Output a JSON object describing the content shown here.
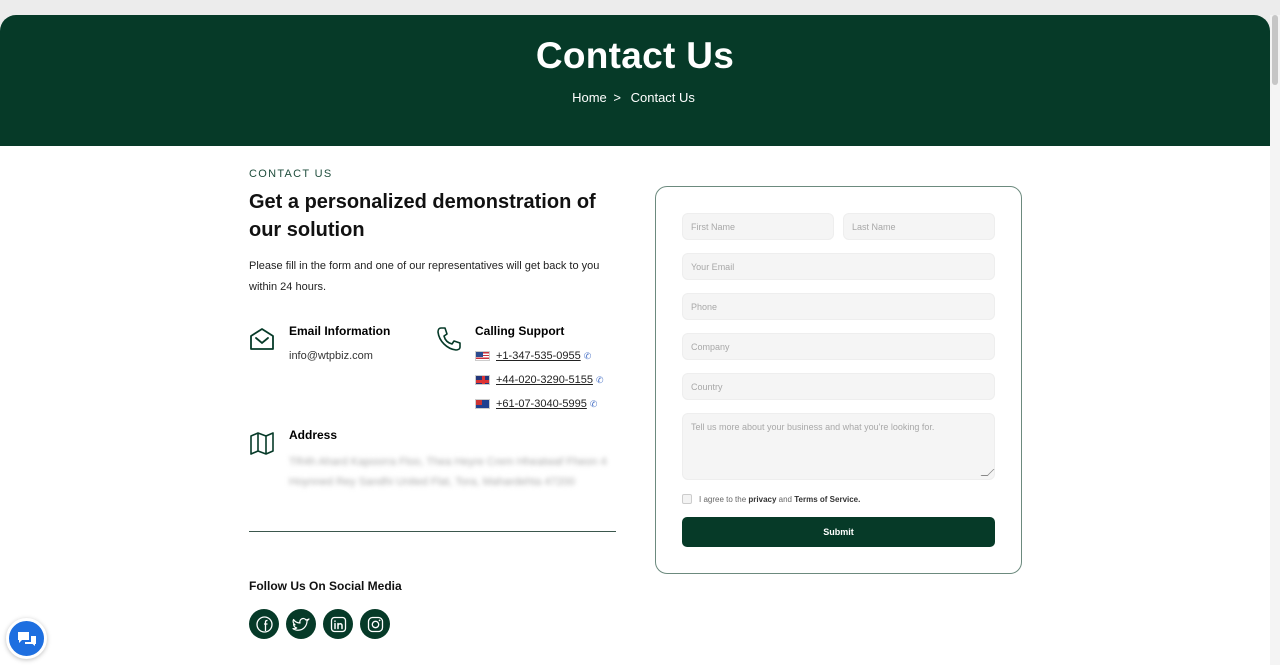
{
  "hero": {
    "title": "Contact Us",
    "breadcrumb_home": "Home",
    "breadcrumb_sep": ">",
    "breadcrumb_current": "Contact Us"
  },
  "intro": {
    "eyebrow": "CONTACT US",
    "headline": "Get a personalized demonstration of our solution",
    "description": "Please fill in the form and one of our representatives will get back to you within 24 hours."
  },
  "email": {
    "title": "Email Information",
    "value": "info@wtpbiz.com",
    "icon": "envelope-open-icon"
  },
  "calling": {
    "title": "Calling Support",
    "icon": "phone-icon",
    "phones": [
      {
        "flag": "us-flag-icon",
        "number": "+1-347-535-0955"
      },
      {
        "flag": "uk-flag-icon",
        "number": "+44-020-3290-5155"
      },
      {
        "flag": "au-flag-icon",
        "number": "+61-07-3040-5995"
      }
    ]
  },
  "address": {
    "title": "Address",
    "icon": "map-icon",
    "line1": "TR4h Ahard Kapoorra Floo, Thea Heyre Crem Hheatwaf Fheon 4",
    "line2": "Hoynned Rey Sandhi United Flat, Tora, Mahardehta 47200"
  },
  "social": {
    "title": "Follow Us On Social Media",
    "icons": [
      "facebook-icon",
      "twitter-icon",
      "linkedin-icon",
      "instagram-icon"
    ]
  },
  "form": {
    "first_name": "First Name",
    "last_name": "Last Name",
    "email": "Your Email",
    "phone": "Phone",
    "company": "Company",
    "country": "Country",
    "message": "Tell us more about your business and what you're looking for.",
    "agree_prefix": "I agree to the",
    "agree_privacy": "privacy",
    "agree_and": "and",
    "agree_terms": "Terms of Service.",
    "submit": "Submit"
  },
  "colors": {
    "brand": "#063a28",
    "chat": "#1e6fe0"
  }
}
